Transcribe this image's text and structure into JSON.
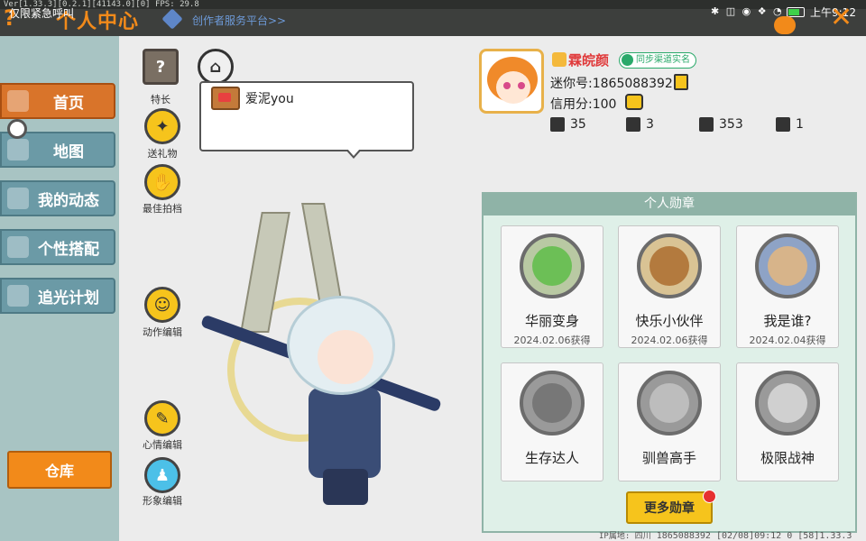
{
  "topbar": {
    "debug_text": "Ver[1.33.3][0.2.1][41143.0][0] FPS: 29.8",
    "emergency_label": "仅限紧急呼叫",
    "title": "个人中心",
    "creator_platform": "创作者服务平台>>",
    "system_icons": "✱ ◫ ◉ ❖ ◔",
    "clock": "上午9:12",
    "battery_level": 0.75
  },
  "sidebar": {
    "items": [
      {
        "label": "首页",
        "active": true
      },
      {
        "label": "地图",
        "active": false
      },
      {
        "label": "我的动态",
        "active": false
      },
      {
        "label": "个性搭配",
        "active": false
      },
      {
        "label": "追光计划",
        "active": false
      }
    ],
    "warehouse_label": "仓库"
  },
  "tools": {
    "specialty": "特长",
    "gift": "送礼物",
    "best_photo": "最佳拍档",
    "action_edit": "动作编辑",
    "mood_edit": "心情编辑",
    "image_edit": "形象编辑"
  },
  "bubble": {
    "name": "爱泥you"
  },
  "profile": {
    "nickname": "霖皖颜",
    "realname_badge": "同步渠道实名",
    "mini_id": "迷你号:1865088392",
    "credit": "信用分:100",
    "stats": [
      {
        "icon": "add-friend-icon",
        "value": "35"
      },
      {
        "icon": "fans-icon",
        "value": "3"
      },
      {
        "icon": "fire-icon",
        "value": "353"
      },
      {
        "icon": "heart-icon",
        "value": "1"
      }
    ]
  },
  "medals": {
    "title": "个人勋章",
    "items": [
      {
        "name": "华丽变身",
        "date": "2024.02.06获得",
        "earned": true
      },
      {
        "name": "快乐小伙伴",
        "date": "2024.02.06获得",
        "earned": true
      },
      {
        "name": "我是谁?",
        "date": "2024.02.04获得",
        "earned": true
      },
      {
        "name": "生存达人",
        "date": "",
        "earned": false
      },
      {
        "name": "驯兽高手",
        "date": "",
        "earned": false
      },
      {
        "name": "极限战神",
        "date": "",
        "earned": false
      }
    ],
    "more_label": "更多勋章"
  },
  "footer": {
    "ip": "IP属地: 四川",
    "text": "1865088392   [02/08]09:12 0  [58]1.33.3"
  },
  "colors": {
    "accent": "#f28a1a",
    "sidebar_bg": "#a8c4c3",
    "nav_active": "#d9742a",
    "panel_bg": "#dff0e8",
    "nickname": "#e0393a"
  }
}
